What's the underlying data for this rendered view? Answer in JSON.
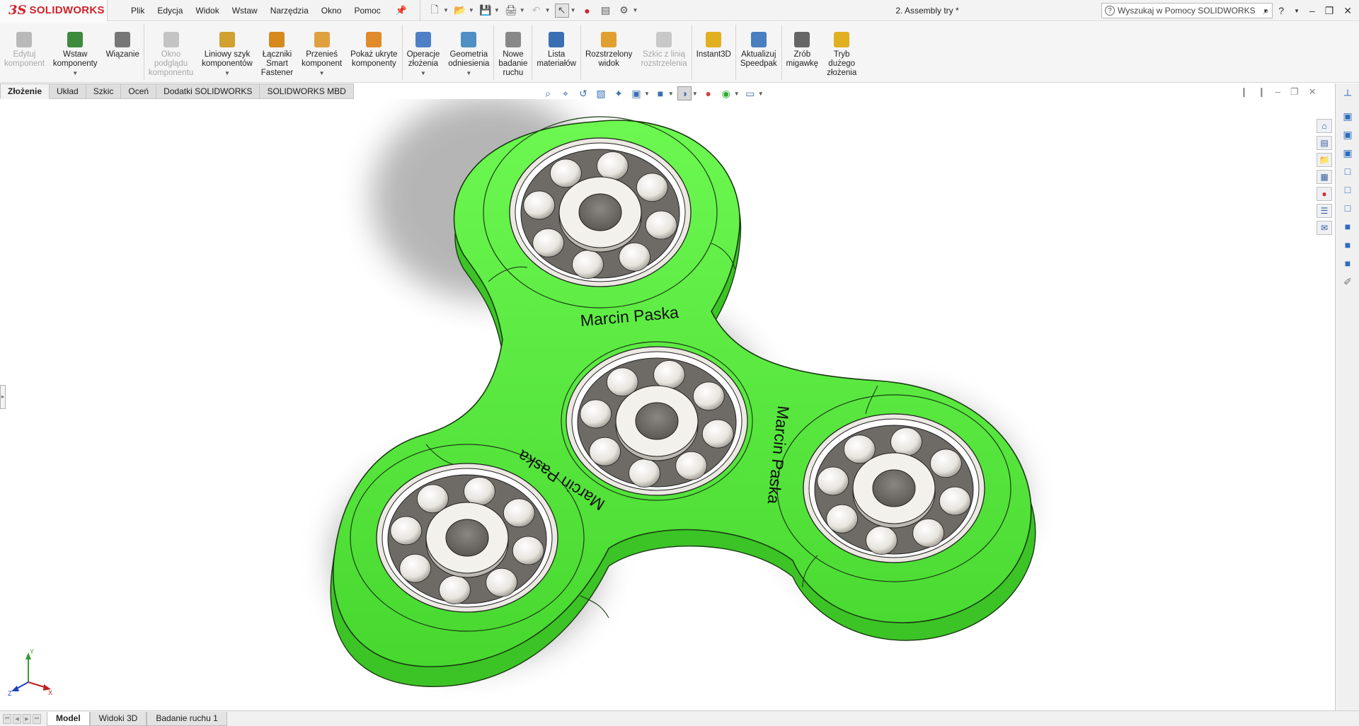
{
  "app": {
    "logo_ds": "3S",
    "logo_solid": "SOLIDWORKS",
    "doc_title": "2. Assembly try *"
  },
  "menu": [
    "Plik",
    "Edycja",
    "Widok",
    "Wstaw",
    "Narzędzia",
    "Okno",
    "Pomoc"
  ],
  "search": {
    "placeholder": "Wyszukaj w Pomocy SOLIDWORKS"
  },
  "ribbon": [
    {
      "label": "Edytuj\nkomponent",
      "disabled": true,
      "color": "#b9b9b9"
    },
    {
      "label": "Wstaw\nkomponenty",
      "disabled": false,
      "caret": true,
      "color": "#3d8b3d"
    },
    {
      "label": "Wiązanie",
      "disabled": false,
      "color": "#777777"
    },
    {
      "label": "Okno\npodglądu\nkomponentu",
      "disabled": true,
      "color": "#c4c4c4"
    },
    {
      "label": "Liniowy szyk\nkomponentów",
      "disabled": false,
      "caret": true,
      "color": "#d0a030"
    },
    {
      "label": "Łączniki\nSmart\nFastener",
      "disabled": false,
      "color": "#d68a1e"
    },
    {
      "label": "Przenieś\nkomponent",
      "disabled": false,
      "caret": true,
      "color": "#e0a040"
    },
    {
      "label": "Pokaż ukryte\nkomponenty",
      "disabled": false,
      "color": "#e08a2a"
    },
    {
      "label": "Operacje\nzłożenia",
      "disabled": false,
      "caret": true,
      "color": "#4f7fc4"
    },
    {
      "label": "Geometria\nodniesienia",
      "disabled": false,
      "caret": true,
      "color": "#4f8fc4"
    },
    {
      "label": "Nowe\nbadanie\nruchu",
      "disabled": false,
      "color": "#888888"
    },
    {
      "label": "Lista\nmateriałów",
      "disabled": false,
      "color": "#3b6fb3"
    },
    {
      "label": "Rozstrzelony\nwidok",
      "disabled": false,
      "color": "#e0a030"
    },
    {
      "label": "Szkic z linią\nrozstrzelenia",
      "disabled": true,
      "color": "#c8c8c8"
    },
    {
      "label": "Instant3D",
      "disabled": false,
      "color": "#e0b020"
    },
    {
      "label": "Aktualizuj\nSpeedpak",
      "disabled": false,
      "color": "#4a7fc0"
    },
    {
      "label": "Zrób\nmigawkę",
      "disabled": false,
      "color": "#666666"
    },
    {
      "label": "Tryb\ndużego\nzłożenia",
      "disabled": false,
      "color": "#e0b020"
    }
  ],
  "tabs": [
    "Złożenie",
    "Układ",
    "Szkic",
    "Oceń",
    "Dodatki SOLIDWORKS",
    "SOLIDWORKS MBD"
  ],
  "active_tab": "Złożenie",
  "model": {
    "engraving": "Marcin Paska",
    "body_color": "#5ef244",
    "ring_color": "#e9e7e2"
  },
  "triad": {
    "y": "Y",
    "x": "X",
    "z": "Z"
  },
  "bottom_tabs": [
    "Model",
    "Widoki 3D",
    "Badanie ruchu 1"
  ],
  "active_bottom_tab": "Model"
}
